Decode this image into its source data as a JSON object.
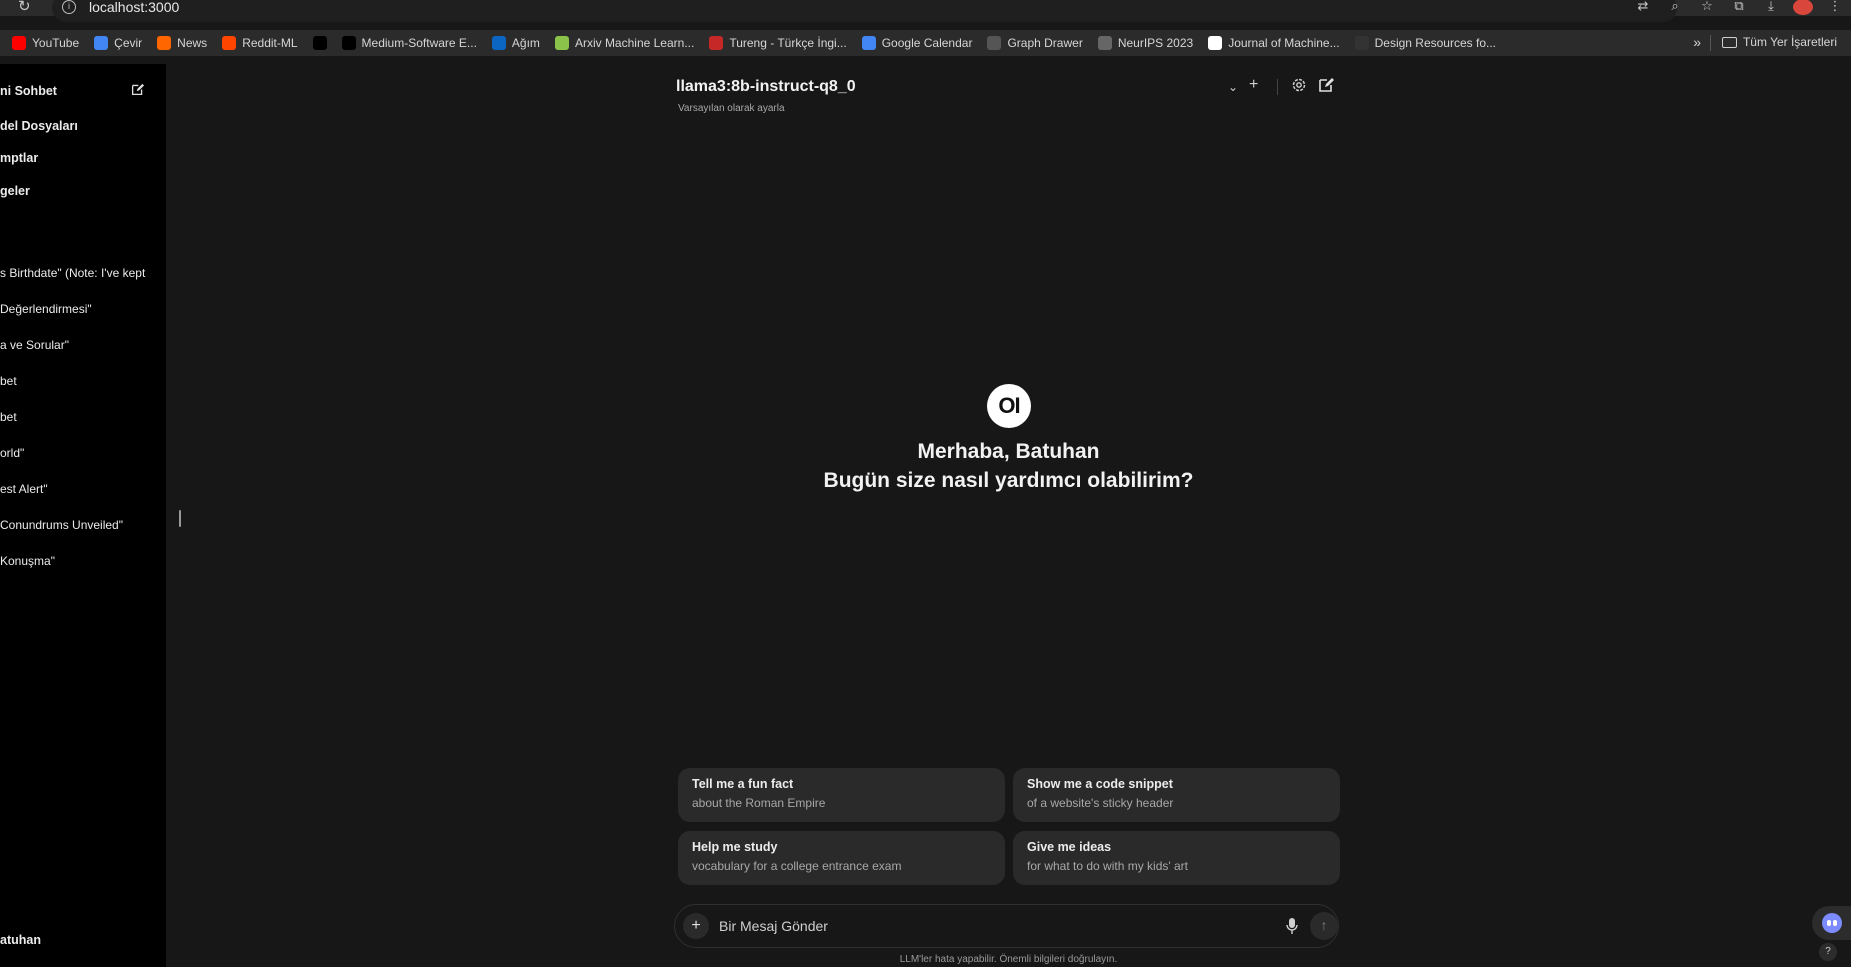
{
  "browser": {
    "url": "localhost:3000",
    "bookmarks": [
      {
        "label": "YouTube",
        "icon": "youtube-icon",
        "color": "#ff0000"
      },
      {
        "label": "Çevir",
        "icon": "translate-icon",
        "color": "#4285f4"
      },
      {
        "label": "News",
        "icon": "hacker-news-icon",
        "color": "#ff6600"
      },
      {
        "label": "Reddit-ML",
        "icon": "reddit-icon",
        "color": "#ff4500"
      },
      {
        "label": "",
        "icon": "x-icon",
        "color": "#000000"
      },
      {
        "label": "Medium-Software E...",
        "icon": "medium-icon",
        "color": "#000000"
      },
      {
        "label": "Ağım",
        "icon": "linkedin-icon",
        "color": "#0a66c2"
      },
      {
        "label": "Arxiv Machine Learn...",
        "icon": "arxiv-icon",
        "color": "#8bc34a"
      },
      {
        "label": "Tureng - Türkçe İngi...",
        "icon": "tureng-icon",
        "color": "#c62828"
      },
      {
        "label": "Google Calendar",
        "icon": "calendar-icon",
        "color": "#4285f4"
      },
      {
        "label": "Graph Drawer",
        "icon": "graph-icon",
        "color": "#555555"
      },
      {
        "label": "NeurIPS 2023",
        "icon": "neurips-icon",
        "color": "#666666"
      },
      {
        "label": "Journal of Machine...",
        "icon": "jmlr-icon",
        "color": "#ffffff"
      },
      {
        "label": "Design Resources fo...",
        "icon": "github-icon",
        "color": "#333333"
      }
    ],
    "all_bookmarks": "Tüm Yer İşaretleri"
  },
  "sidebar": {
    "new_chat": "ni Sohbet",
    "nav": [
      "del Dosyaları",
      "mptlar",
      "geler"
    ],
    "chats": [
      "s Birthdate\" (Note: I've kept",
      " Değerlendirmesi\"",
      "a ve Sorular\"",
      "bet",
      "bet",
      "orld\"",
      "est Alert\"",
      " Conundrums Unveiled\"",
      " Konuşma\""
    ],
    "user": "atuhan"
  },
  "header": {
    "model": "llama3:8b-instruct-q8_0",
    "set_default": "Varsayılan olarak ayarla"
  },
  "main": {
    "logo_text": "OI",
    "greeting": "Merhaba, Batuhan",
    "prompt": "Bugün size nasıl yardımcı olabilirim?",
    "suggestions": [
      {
        "title": "Tell me a fun fact",
        "subtitle": "about the Roman Empire"
      },
      {
        "title": "Show me a code snippet",
        "subtitle": "of a website's sticky header"
      },
      {
        "title": "Help me study",
        "subtitle": "vocabulary for a college entrance exam"
      },
      {
        "title": "Give me ideas",
        "subtitle": "for what to do with my kids' art"
      }
    ],
    "input_placeholder": "Bir Mesaj Gönder",
    "disclaimer": "LLM'ler hata yapabilir. Önemli bilgileri doğrulayın."
  }
}
